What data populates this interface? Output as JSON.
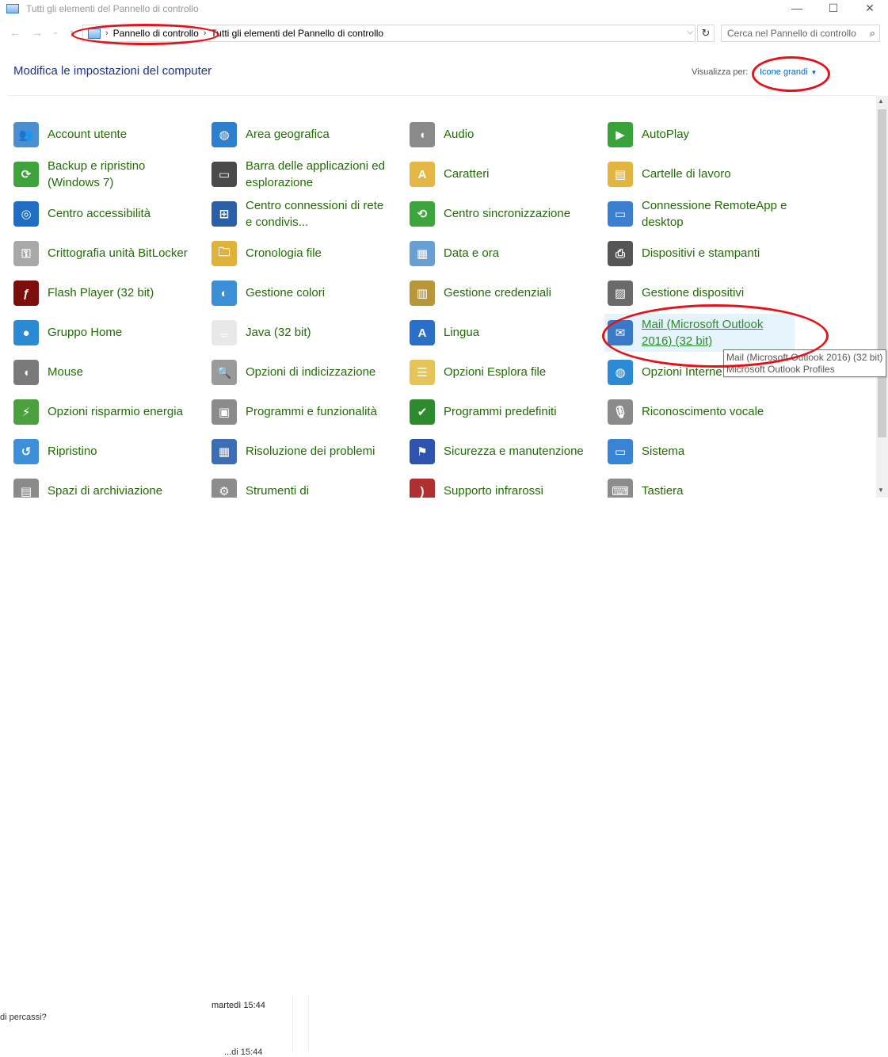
{
  "window": {
    "title": "Tutti gli elementi del Pannello di controllo",
    "minimize": "—",
    "maximize": "☐",
    "close": "✕"
  },
  "nav": {
    "back": "←",
    "forward": "→",
    "up": "↑",
    "breadcrumb": [
      "Pannello di controllo",
      "Tutti gli elementi del Pannello di controllo"
    ],
    "separator": "›",
    "dropdown": "⌵",
    "refresh": "↻",
    "search_placeholder": "Cerca nel Pannello di controllo",
    "search_icon": "⌕"
  },
  "header": {
    "title": "Modifica le impostazioni del computer",
    "view_by_label": "Visualizza per:",
    "view_by_value": "Icone grandi",
    "caret": "▼"
  },
  "items": [
    [
      {
        "label": "Account utente",
        "icon": "users-icon",
        "color": "#4b8fd1",
        "glyph": "👥"
      },
      {
        "label": "Backup e ripristino\n(Windows 7)",
        "icon": "backup-icon",
        "color": "#3da33b",
        "glyph": "⟳"
      },
      {
        "label": "Centro accessibilità",
        "icon": "accessibility-icon",
        "color": "#1e6fc4",
        "glyph": "◎"
      },
      {
        "label": "Crittografia unità BitLocker",
        "icon": "bitlocker-icon",
        "color": "#a8a8a8",
        "glyph": "⚿"
      },
      {
        "label": "Flash Player (32 bit)",
        "icon": "flash-icon",
        "color": "#7d0e0e",
        "glyph": "ƒ"
      },
      {
        "label": "Gruppo Home",
        "icon": "homegroup-icon",
        "color": "#2a8bd4",
        "glyph": "●"
      },
      {
        "label": "Mouse",
        "icon": "mouse-icon",
        "color": "#7a7a7a",
        "glyph": "◖"
      },
      {
        "label": "Opzioni risparmio energia",
        "icon": "power-icon",
        "color": "#4aa03c",
        "glyph": "⚡"
      },
      {
        "label": "Ripristino",
        "icon": "recovery-icon",
        "color": "#3c8fd8",
        "glyph": "↺"
      },
      {
        "label": "Spazi di archiviazione",
        "icon": "storage-icon",
        "color": "#8a8a8a",
        "glyph": "▤"
      }
    ],
    [
      {
        "label": "Area geografica",
        "icon": "globe-clock-icon",
        "color": "#2f7fcf",
        "glyph": "◍"
      },
      {
        "label": "Barra delle applicazioni ed\nesplorazione",
        "icon": "taskbar-icon",
        "color": "#4a4a4a",
        "glyph": "▭"
      },
      {
        "label": "Centro connessioni di rete\ne condivis...",
        "icon": "network-icon",
        "color": "#2b5fa8",
        "glyph": "⊞"
      },
      {
        "label": "Cronologia file",
        "icon": "file-history-icon",
        "color": "#e0b23c",
        "glyph": "🗀"
      },
      {
        "label": "Gestione colori",
        "icon": "color-management-icon",
        "color": "#3b8fd6",
        "glyph": "◐"
      },
      {
        "label": "Java (32 bit)",
        "icon": "java-icon",
        "color": "#e8e8e8",
        "glyph": "☕"
      },
      {
        "label": "Opzioni di indicizzazione",
        "icon": "indexing-icon",
        "color": "#9a9a9a",
        "glyph": "🔍"
      },
      {
        "label": "Programmi e funzionalità",
        "icon": "programs-icon",
        "color": "#8b8b8b",
        "glyph": "▣"
      },
      {
        "label": "Risoluzione dei problemi",
        "icon": "troubleshoot-icon",
        "color": "#3b6eb5",
        "glyph": "▦"
      },
      {
        "label": "Strumenti di",
        "icon": "admin-tools-icon",
        "color": "#8c8c8c",
        "glyph": "⚙"
      }
    ],
    [
      {
        "label": "Audio",
        "icon": "speaker-icon",
        "color": "#8a8a8a",
        "glyph": "◖"
      },
      {
        "label": "Caratteri",
        "icon": "fonts-icon",
        "color": "#e3b646",
        "glyph": "A"
      },
      {
        "label": "Centro sincronizzazione",
        "icon": "sync-icon",
        "color": "#3ca53c",
        "glyph": "⟲"
      },
      {
        "label": "Data e ora",
        "icon": "calendar-icon",
        "color": "#6a9fd4",
        "glyph": "▦"
      },
      {
        "label": "Gestione credenziali",
        "icon": "credentials-icon",
        "color": "#b8963a",
        "glyph": "▥"
      },
      {
        "label": "Lingua",
        "icon": "language-icon",
        "color": "#2a6fc8",
        "glyph": "A"
      },
      {
        "label": "Opzioni Esplora file",
        "icon": "folder-options-icon",
        "color": "#e5c458",
        "glyph": "☰"
      },
      {
        "label": "Programmi predefiniti",
        "icon": "default-programs-icon",
        "color": "#2c8b2c",
        "glyph": "✔"
      },
      {
        "label": "Sicurezza e manutenzione",
        "icon": "flag-icon",
        "color": "#2d55b0",
        "glyph": "⚑"
      },
      {
        "label": "Supporto infrarossi",
        "icon": "infrared-icon",
        "color": "#b03030",
        "glyph": ")"
      }
    ],
    [
      {
        "label": "AutoPlay",
        "icon": "autoplay-icon",
        "color": "#3aa23a",
        "glyph": "▶"
      },
      {
        "label": "Cartelle di lavoro",
        "icon": "work-folders-icon",
        "color": "#e2b541",
        "glyph": "▤"
      },
      {
        "label": "Connessione RemoteApp e\ndesktop",
        "icon": "remoteapp-icon",
        "color": "#3b7fd0",
        "glyph": "▭"
      },
      {
        "label": "Dispositivi e stampanti",
        "icon": "printer-icon",
        "color": "#555555",
        "glyph": "⎙"
      },
      {
        "label": "Gestione dispositivi",
        "icon": "device-manager-icon",
        "color": "#6a6a6a",
        "glyph": "▨"
      },
      {
        "label": "Mail (Microsoft Outlook\n2016) (32 bit)",
        "icon": "mail-icon",
        "color": "#3a78c8",
        "glyph": "✉",
        "hover": true
      },
      {
        "label": "Opzioni Interne",
        "icon": "internet-options-icon",
        "color": "#2d8bd6",
        "glyph": "◍"
      },
      {
        "label": "Riconoscimento vocale",
        "icon": "microphone-icon",
        "color": "#8a8a8a",
        "glyph": "🎙"
      },
      {
        "label": "Sistema",
        "icon": "system-icon",
        "color": "#3a84d6",
        "glyph": "▭"
      },
      {
        "label": "Tastiera",
        "icon": "keyboard-icon",
        "color": "#8c8c8c",
        "glyph": "⌨"
      }
    ]
  ],
  "tooltip": {
    "line1": "Mail (Microsoft Outlook 2016) (32 bit)",
    "line2": "Microsoft Outlook Profiles"
  },
  "background": {
    "timestamp": "martedì 15:44",
    "snippet": "di percassi?",
    "timestamp2": "...di 15:44"
  },
  "scrollbar": {
    "up": "▲",
    "down": "▼"
  },
  "annotation_color": "#e3131b"
}
